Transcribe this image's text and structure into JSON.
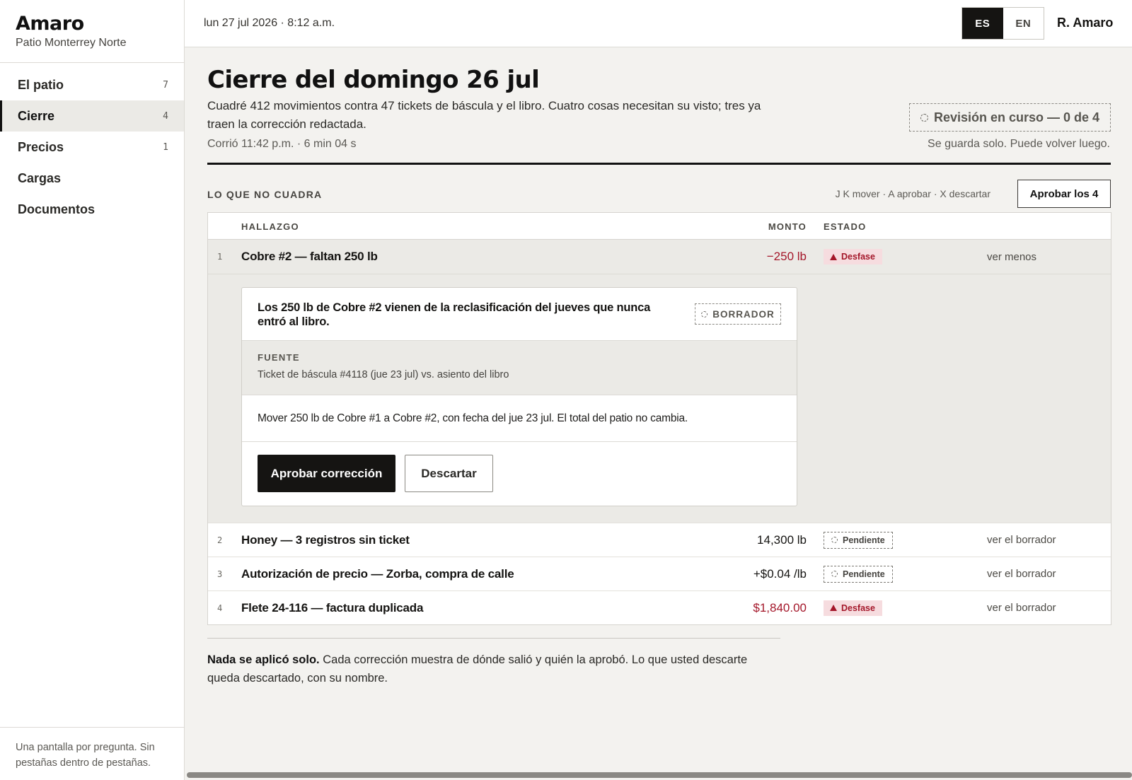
{
  "brand": {
    "name": "Amaro",
    "subtitle": "Patio Monterrey Norte"
  },
  "nav": {
    "items": [
      {
        "label": "El patio",
        "count": "7",
        "active": false
      },
      {
        "label": "Cierre",
        "count": "4",
        "active": true
      },
      {
        "label": "Precios",
        "count": "1",
        "active": false
      },
      {
        "label": "Cargas",
        "count": "",
        "active": false
      },
      {
        "label": "Documentos",
        "count": "",
        "active": false
      }
    ],
    "footer": "Una pantalla por pregunta. Sin pestañas dentro de pestañas."
  },
  "topbar": {
    "datetime": "lun 27 jul 2026 · 8:12 a.m.",
    "lang": {
      "es": "ES",
      "en": "EN",
      "selected": "ES"
    },
    "user": "R. Amaro"
  },
  "page": {
    "title": "Cierre del domingo 26 jul",
    "summary": "Cuadré 412 movimientos contra 47 tickets de báscula y el libro. Cuatro cosas necesitan su visto; tres ya traen la corrección redactada.",
    "ran": "Corrió 11:42 p.m. · 6 min 04 s",
    "review_status": "Revisión en curso — 0 de 4",
    "autosave": "Se guarda solo. Puede volver luego."
  },
  "findings": {
    "section_label": "LO QUE NO CUADRA",
    "shortcuts": "J K mover · A aprobar · X descartar",
    "approve_all": "Aprobar los 4",
    "columns": {
      "finding": "HALLAZGO",
      "amount": "MONTO",
      "status": "ESTADO"
    },
    "rows": [
      {
        "num": "1",
        "title": "Cobre #2 — faltan 250 lb",
        "amount": "−250 lb",
        "status": "Desfase",
        "link": "ver menos"
      },
      {
        "num": "2",
        "title": "Honey — 3 registros sin ticket",
        "amount": "14,300 lb",
        "status": "Pendiente",
        "link": "ver el borrador"
      },
      {
        "num": "3",
        "title": "Autorización de precio — Zorba, compra de calle",
        "amount": "+$0.04 /lb",
        "status": "Pendiente",
        "link": "ver el borrador"
      },
      {
        "num": "4",
        "title": "Flete 24-116 — factura duplicada",
        "amount": "$1,840.00",
        "status": "Desfase",
        "link": "ver el borrador"
      }
    ],
    "detail": {
      "headline": "Los 250 lb de Cobre #2 vienen de la reclasificación del jueves que nunca entró al libro.",
      "draft_badge": "BORRADOR",
      "source_label": "FUENTE",
      "source_text": "Ticket de báscula #4118 (jue 23 jul) vs. asiento del libro",
      "fix": "Mover 250 lb de Cobre #1 a Cobre #2, con fecha del jue 23 jul. El total del patio no cambia.",
      "approve": "Aprobar corrección",
      "discard": "Descartar"
    }
  },
  "note": {
    "bold": "Nada se aplicó solo.",
    "text": "Cada corrección muestra de dónde salió y quién la aprobó. Lo que usted descarte queda descartado, con su nombre."
  },
  "colors": {
    "accent_dark": "#151412",
    "alert_red": "#a4172a",
    "alert_bg": "#f6dcdf",
    "page_bg": "#f3f2ef"
  }
}
